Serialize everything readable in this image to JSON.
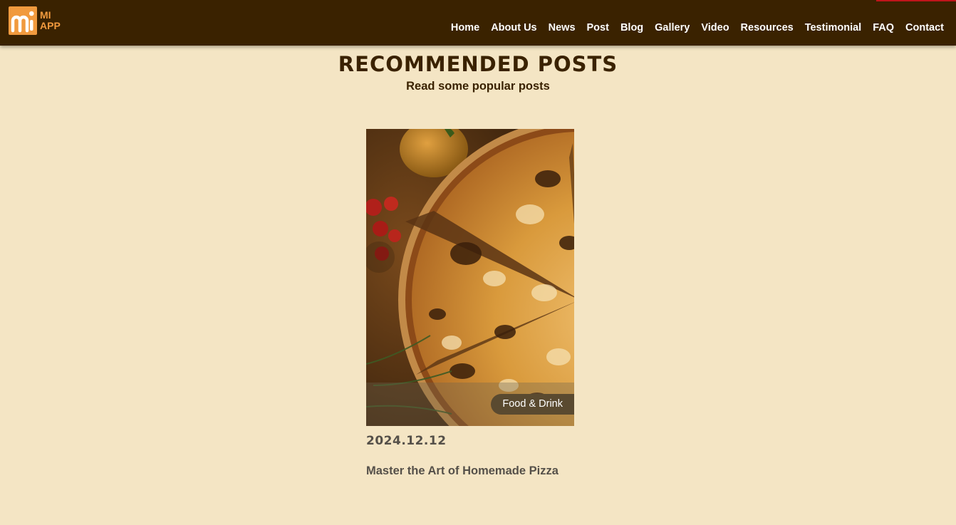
{
  "brand": {
    "name_line1": "MI",
    "name_line2": "APP",
    "accent_color": "#f19a3e",
    "navbar_color": "#3a2200",
    "page_background": "#f4e5c4"
  },
  "nav": {
    "items": [
      {
        "label": "Home"
      },
      {
        "label": "About Us"
      },
      {
        "label": "News"
      },
      {
        "label": "Post"
      },
      {
        "label": "Blog"
      },
      {
        "label": "Gallery"
      },
      {
        "label": "Video"
      },
      {
        "label": "Resources"
      },
      {
        "label": "Testimonial"
      },
      {
        "label": "FAQ"
      },
      {
        "label": "Contact"
      }
    ]
  },
  "section": {
    "title": "RECOMMENDED POSTS",
    "subtitle": "Read some popular posts"
  },
  "posts": [
    {
      "image_icon": "pizza-photo",
      "category": "Food & Drink",
      "date": "2024.12.12",
      "title": "Master the Art of Homemade Pizza"
    }
  ]
}
